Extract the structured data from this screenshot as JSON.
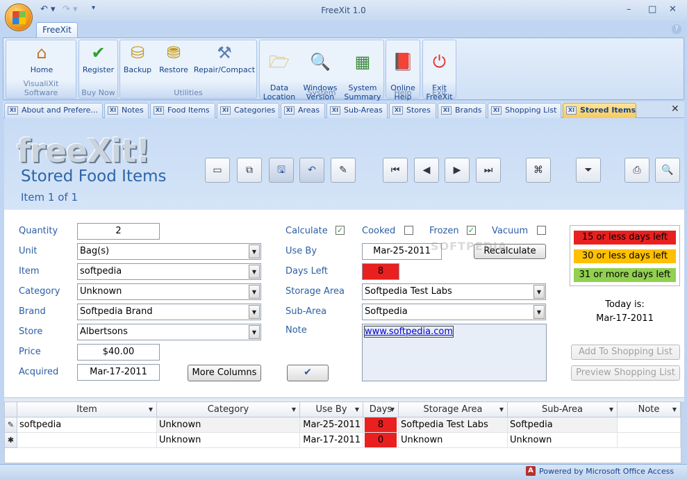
{
  "app": {
    "title": "FreeXit 1.0"
  },
  "ribbon": {
    "tab": "FreeXit",
    "groups": [
      {
        "label": "VisualiXit Software",
        "buttons": [
          {
            "label": "Home",
            "icon": "home-icon"
          }
        ]
      },
      {
        "label": "Buy Now",
        "buttons": [
          {
            "label": "Register",
            "icon": "checkmark-icon"
          }
        ]
      },
      {
        "label": "Utilities",
        "buttons": [
          {
            "label": "Backup",
            "icon": "database-icon"
          },
          {
            "label": "Restore",
            "icon": "database-restore-icon"
          },
          {
            "label": "Repair/Compact",
            "icon": "tools-icon"
          }
        ]
      },
      {
        "label": "System",
        "buttons": [
          {
            "label": "Data\nLocation",
            "icon": "folder-icon"
          },
          {
            "label": "Windows\nVersion",
            "icon": "magnifier-icon"
          },
          {
            "label": "System\nSummary",
            "icon": "spreadsheet-icon"
          }
        ]
      },
      {
        "label": "Help",
        "buttons": [
          {
            "label": "Online\nHelp",
            "icon": "book-icon"
          }
        ]
      },
      {
        "label": "Exit",
        "buttons": [
          {
            "label": "Exit\nFreeXit",
            "icon": "power-icon"
          }
        ]
      }
    ]
  },
  "doc_tabs": [
    "About and Prefere...",
    "Notes",
    "Food Items",
    "Categories",
    "Areas",
    "Sub-Areas",
    "Stores",
    "Brands",
    "Shopping List",
    "Stored Items"
  ],
  "header": {
    "logo": "freeXit!",
    "title": "Stored Food Items",
    "record": "Item 1 of 1"
  },
  "form": {
    "labels": {
      "quantity": "Quantity",
      "unit": "Unit",
      "item": "Item",
      "category": "Category",
      "brand": "Brand",
      "store": "Store",
      "price": "Price",
      "acquired": "Acquired",
      "calculate": "Calculate",
      "cooked": "Cooked",
      "frozen": "Frozen",
      "vacuum": "Vacuum",
      "use_by": "Use By",
      "days_left": "Days Left",
      "storage_area": "Storage Area",
      "sub_area": "Sub-Area",
      "note": "Note"
    },
    "values": {
      "quantity": "2",
      "unit": "Bag(s)",
      "item": "softpedia",
      "category": "Unknown",
      "brand": "Softpedia Brand",
      "store": "Albertsons",
      "price": "$40.00",
      "acquired": "Mar-17-2011",
      "use_by": "Mar-25-2011",
      "days_left": "8",
      "storage_area": "Softpedia Test Labs",
      "sub_area": "Softpedia",
      "note": "www.softpedia.com"
    },
    "checks": {
      "calculate": true,
      "cooked": false,
      "frozen": true,
      "vacuum": false
    },
    "buttons": {
      "more_columns": "More Columns",
      "recalculate": "Recalculate",
      "add_shopping": "Add To Shopping List",
      "preview_shopping": "Preview Shopping List"
    },
    "legend": [
      {
        "label": "15 or less days left",
        "color": "#e8201f"
      },
      {
        "label": "30 or less days left",
        "color": "#ffc000"
      },
      {
        "label": "31 or more days left",
        "color": "#92d050"
      }
    ],
    "today_label": "Today is:",
    "today_value": "Mar-17-2011"
  },
  "grid": {
    "columns": [
      "Item",
      "Category",
      "Use By",
      "Days",
      "Storage Area",
      "Sub-Area",
      "Note"
    ],
    "rows": [
      {
        "item": "softpedia",
        "category": "Unknown",
        "use_by": "Mar-25-2011",
        "days": "8",
        "storage_area": "Softpedia Test Labs",
        "sub_area": "Softpedia",
        "note": ""
      },
      {
        "item": "",
        "category": "Unknown",
        "use_by": "Mar-17-2011",
        "days": "0",
        "storage_area": "Unknown",
        "sub_area": "Unknown",
        "note": ""
      }
    ]
  },
  "status": {
    "text": "Powered by Microsoft Office Access"
  },
  "watermark": "SOFTPEDIA"
}
